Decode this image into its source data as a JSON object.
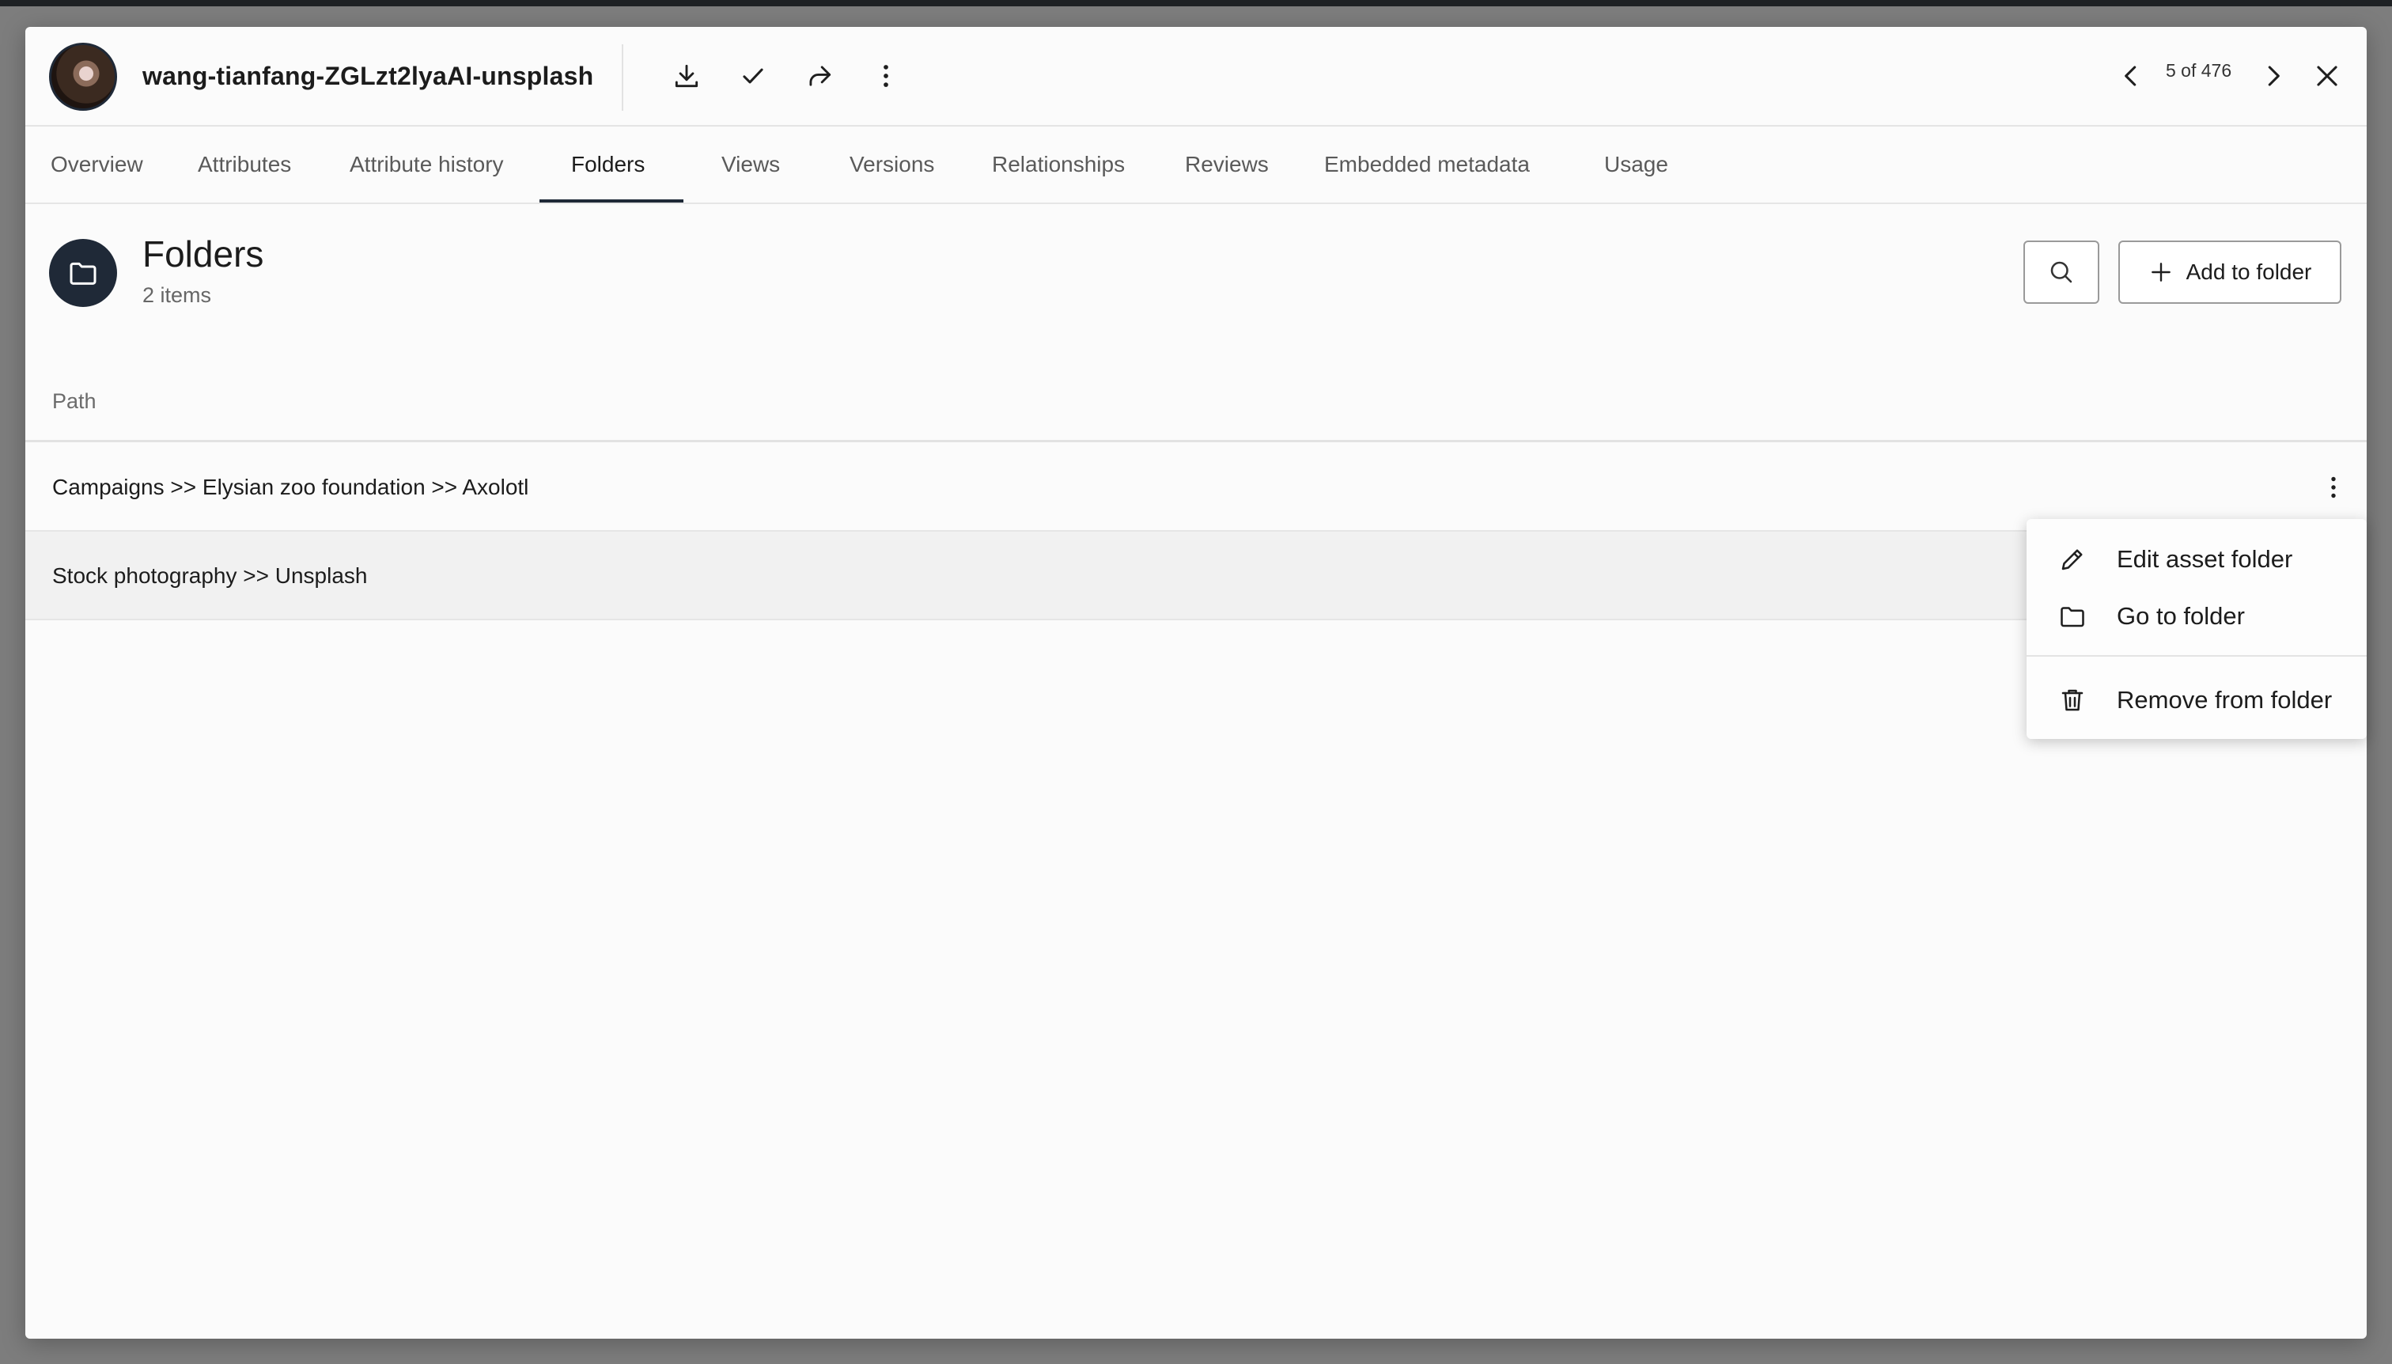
{
  "header": {
    "asset_title": "wang-tianfang-ZGLzt2lyaAI-unsplash",
    "pager": "5 of 476",
    "icons": [
      "download-icon",
      "check-icon",
      "share-icon",
      "more-vertical-icon",
      "chevron-left-icon",
      "chevron-right-icon",
      "close-icon"
    ]
  },
  "tabs": [
    {
      "label": "Overview"
    },
    {
      "label": "Attributes"
    },
    {
      "label": "Attribute history"
    },
    {
      "label": "Folders",
      "active": true
    },
    {
      "label": "Views"
    },
    {
      "label": "Versions"
    },
    {
      "label": "Relationships"
    },
    {
      "label": "Reviews"
    },
    {
      "label": "Embedded metadata"
    },
    {
      "label": "Usage"
    }
  ],
  "section": {
    "title": "Folders",
    "subtitle": "2 items",
    "add_button_label": "Add to folder"
  },
  "table": {
    "column_header": "Path",
    "rows": [
      {
        "path": "Campaigns >> Elysian zoo foundation >> Axolotl"
      },
      {
        "path": "Stock photography >> Unsplash"
      }
    ]
  },
  "context_menu": {
    "items": [
      {
        "label": "Edit asset folder",
        "icon": "pencil-icon"
      },
      {
        "label": "Go to folder",
        "icon": "folder-icon"
      },
      {
        "label": "Remove from folder",
        "icon": "trash-icon"
      }
    ]
  },
  "colors": {
    "accent": "#1f2937",
    "surface": "#fbfbfb",
    "hover_row": "#f1f1f1"
  }
}
